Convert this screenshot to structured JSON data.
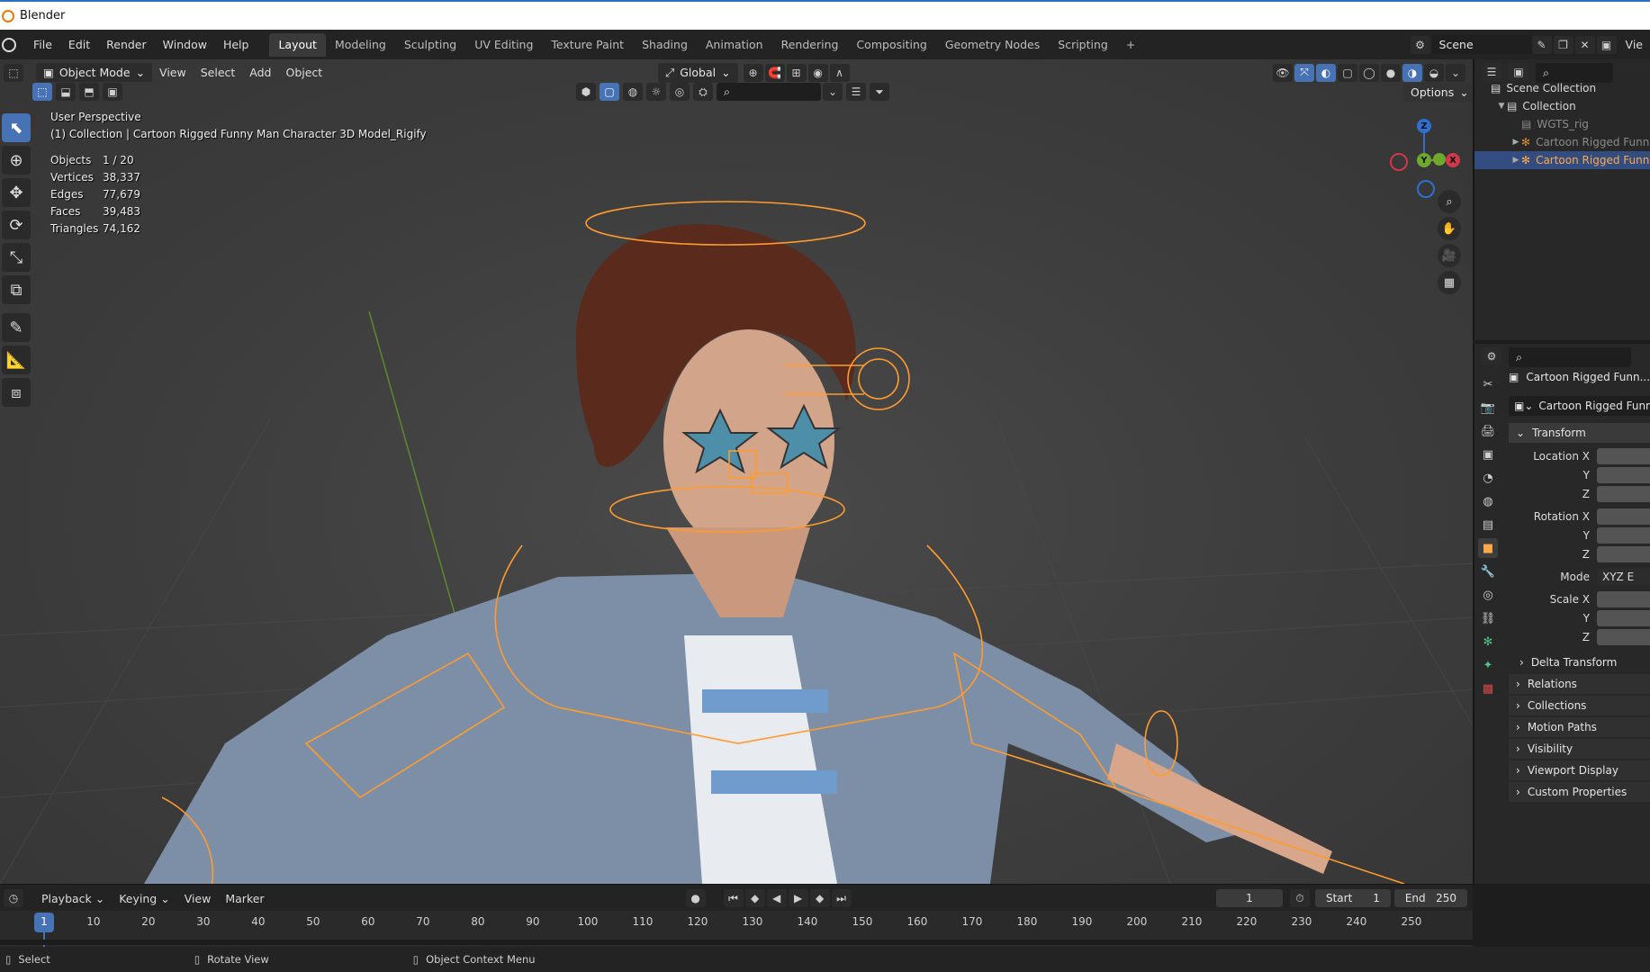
{
  "window": {
    "title": "Blender"
  },
  "menu": [
    "File",
    "Edit",
    "Render",
    "Window",
    "Help"
  ],
  "workspaces": [
    "Layout",
    "Modeling",
    "Sculpting",
    "UV Editing",
    "Texture Paint",
    "Shading",
    "Animation",
    "Rendering",
    "Compositing",
    "Geometry Nodes",
    "Scripting"
  ],
  "active_workspace": "Layout",
  "scene": {
    "name": "Scene",
    "view_layer_label": "Vie"
  },
  "viewport": {
    "mode": "Object Mode",
    "header_menus": [
      "View",
      "Select",
      "Add",
      "Object"
    ],
    "orientation": "Global",
    "options_label": "Options",
    "perspective": "User Perspective",
    "context": "(1) Collection | Cartoon Rigged Funny Man Character 3D Model_Rigify",
    "stats": [
      {
        "label": "Objects",
        "value": "1 / 20"
      },
      {
        "label": "Vertices",
        "value": "38,337"
      },
      {
        "label": "Edges",
        "value": "77,679"
      },
      {
        "label": "Faces",
        "value": "39,483"
      },
      {
        "label": "Triangles",
        "value": "74,162"
      }
    ],
    "gizmo_axes": {
      "z": "Z",
      "y": "Y",
      "x": "X"
    }
  },
  "outliner": {
    "items": [
      {
        "label": "Scene Collection",
        "level": 0
      },
      {
        "label": "Collection",
        "level": 1
      },
      {
        "label": "WGTS_rig",
        "level": 2
      },
      {
        "label": "Cartoon Rigged Funn",
        "level": 2
      },
      {
        "label": "Cartoon Rigged Funn",
        "level": 2
      }
    ]
  },
  "properties": {
    "object_name": "Cartoon Rigged Funn...ac",
    "data_name": "Cartoon Rigged Funn...",
    "transform_label": "Transform",
    "fields": {
      "location_x": "Location X",
      "location_y": "Y",
      "location_z": "Z",
      "rotation_x": "Rotation X",
      "rotation_y": "Y",
      "rotation_z": "Z",
      "mode_label": "Mode",
      "mode_value": "XYZ E",
      "scale_x": "Scale X",
      "scale_y": "Y",
      "scale_z": "Z"
    },
    "delta_transform": "Delta Transform",
    "sections": [
      "Relations",
      "Collections",
      "Motion Paths",
      "Visibility",
      "Viewport Display",
      "Custom Properties"
    ]
  },
  "timeline": {
    "menus": [
      "Playback",
      "Keying",
      "View",
      "Marker"
    ],
    "current_frame": "1",
    "start_label": "Start",
    "start": "1",
    "end_label": "End",
    "end": "250",
    "ruler": [
      "1",
      "10",
      "20",
      "30",
      "40",
      "50",
      "60",
      "70",
      "80",
      "90",
      "100",
      "110",
      "120",
      "130",
      "140",
      "150",
      "160",
      "170",
      "180",
      "190",
      "200",
      "210",
      "220",
      "230",
      "240",
      "250"
    ]
  },
  "statusbar": {
    "select": "Select",
    "rotate": "Rotate View",
    "context_menu": "Object Context Menu"
  },
  "colors": {
    "accent": "#4772b3",
    "selection_orange": "#ffa500",
    "background": "#3d3d3d"
  }
}
